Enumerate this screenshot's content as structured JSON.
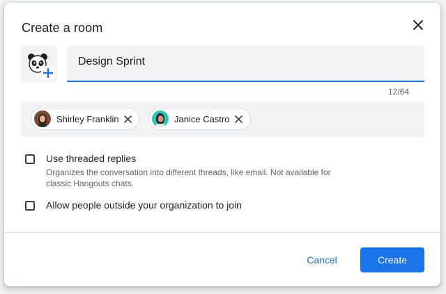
{
  "dialog": {
    "title": "Create a room",
    "close_icon": "close-icon",
    "avatar_picker_icons": [
      "panda-icon",
      "add-icon"
    ],
    "name_field": {
      "value": "Design Sprint",
      "counter": "12/64"
    },
    "members": [
      {
        "name": "Shirley Franklin",
        "avatar": "avatar-shirley",
        "remove_icon": "close-icon"
      },
      {
        "name": "Janice Castro",
        "avatar": "avatar-janice",
        "remove_icon": "close-icon"
      }
    ],
    "options": [
      {
        "label": "Use threaded replies",
        "description": "Organizes the conversation into different threads, like email. Not available for classic Hangouts chats.",
        "checked": false
      },
      {
        "label": "Allow people outside your organization to join",
        "checked": false
      }
    ],
    "buttons": {
      "cancel": "Cancel",
      "create": "Create"
    }
  },
  "colors": {
    "accent": "#1a73e8",
    "field_background": "#f1f3f4",
    "text_primary": "#202124",
    "text_secondary": "#5f6368"
  }
}
